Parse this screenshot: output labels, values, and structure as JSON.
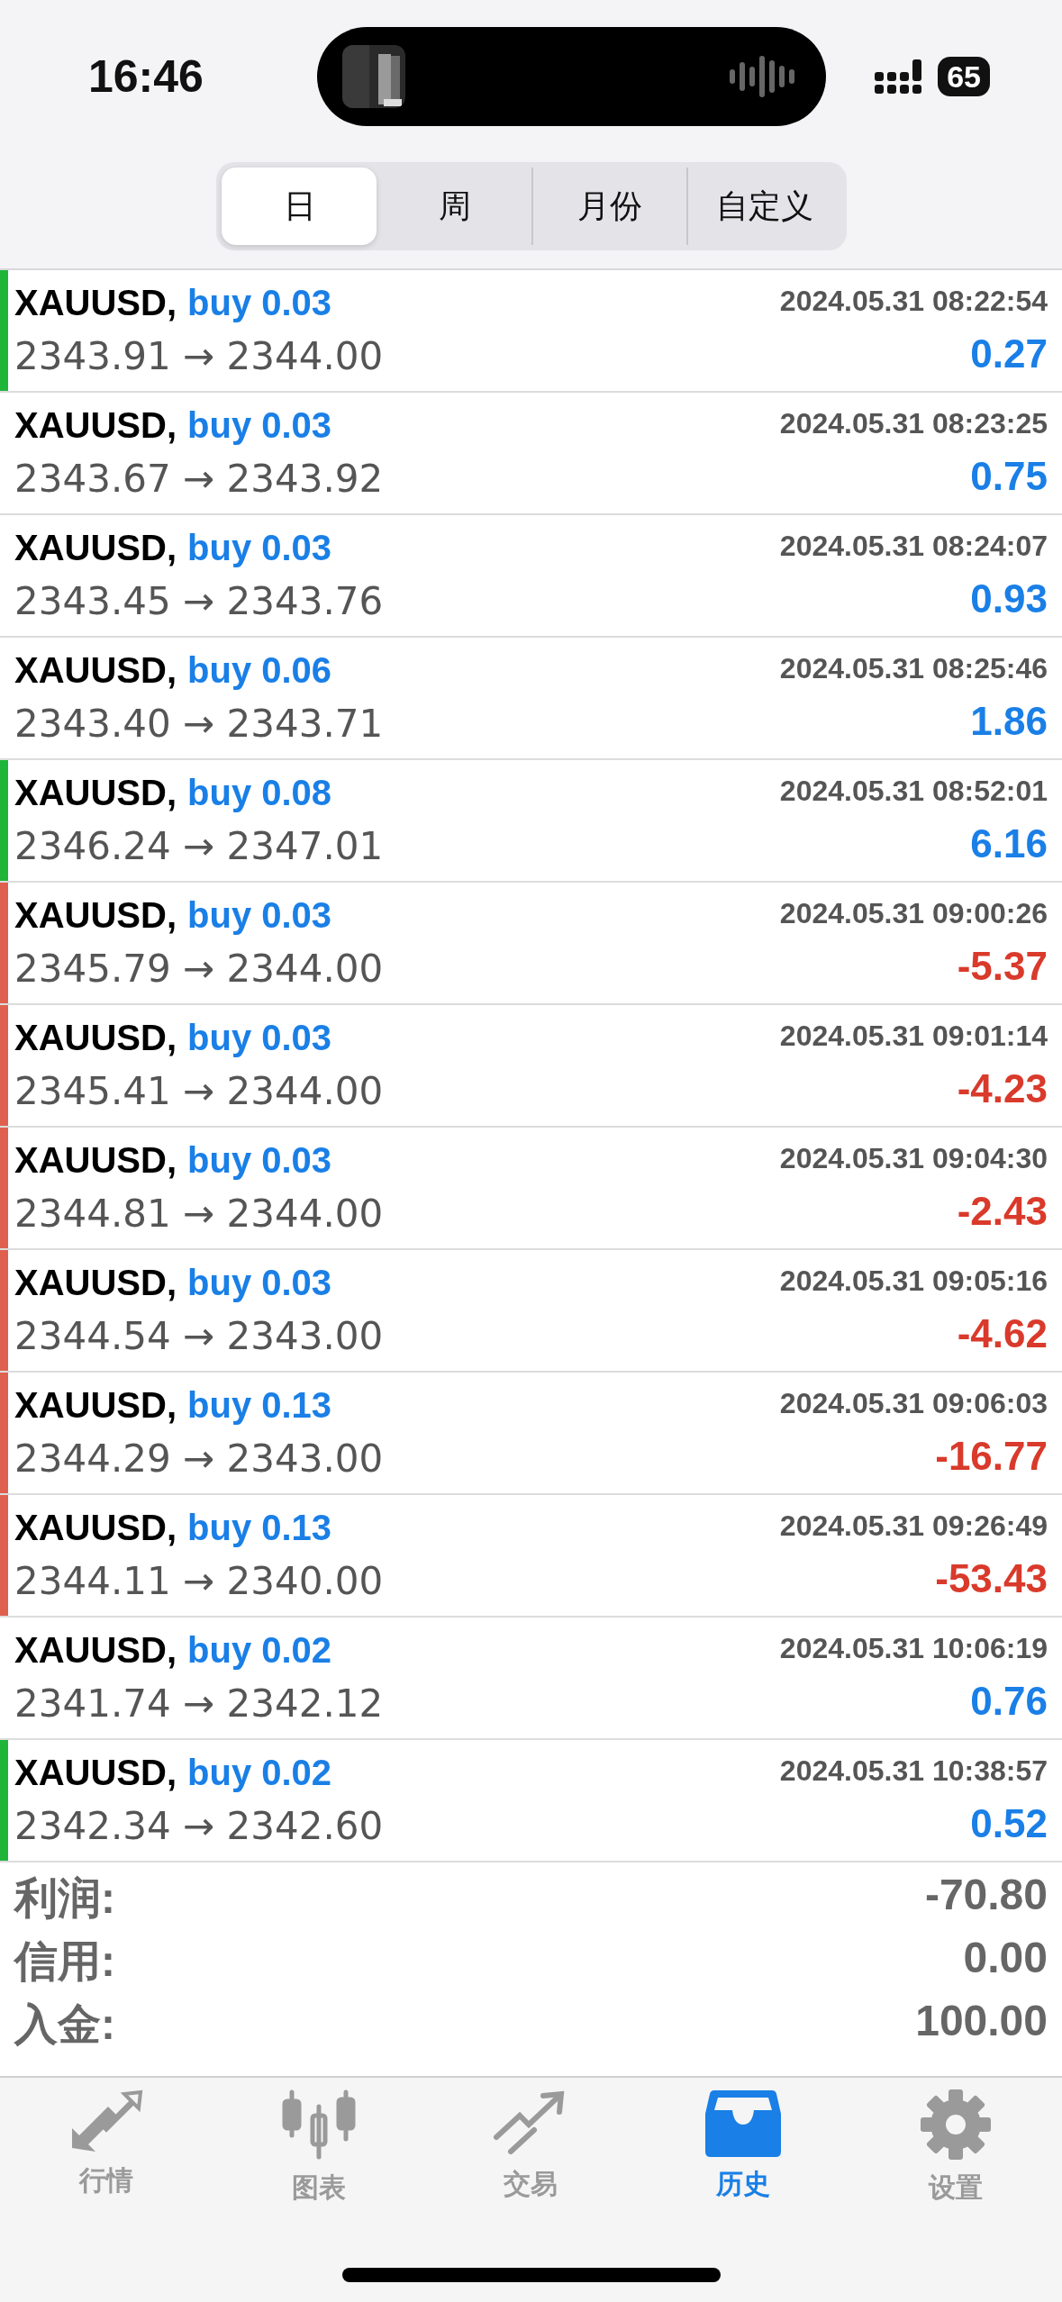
{
  "status_bar": {
    "time": "16:46",
    "battery": "65"
  },
  "tabs": [
    {
      "label": "日",
      "selected": true
    },
    {
      "label": "周",
      "selected": false
    },
    {
      "label": "月份",
      "selected": false
    },
    {
      "label": "自定义",
      "selected": false
    }
  ],
  "deals": [
    {
      "symbol": "XAUUSD,",
      "side": "buy 0.03",
      "time": "2024.05.31 08:22:54",
      "prices": "2343.91 → 2344.00",
      "profit": "0.27",
      "kind": "gain",
      "color": "#1fb53a"
    },
    {
      "symbol": "XAUUSD,",
      "side": "buy 0.03",
      "time": "2024.05.31 08:23:25",
      "prices": "2343.67 → 2343.92",
      "profit": "0.75",
      "kind": "gain"
    },
    {
      "symbol": "XAUUSD,",
      "side": "buy 0.03",
      "time": "2024.05.31 08:24:07",
      "prices": "2343.45 → 2343.76",
      "profit": "0.93",
      "kind": "gain"
    },
    {
      "symbol": "XAUUSD,",
      "side": "buy 0.06",
      "time": "2024.05.31 08:25:46",
      "prices": "2343.40 → 2343.71",
      "profit": "1.86",
      "kind": "gain"
    },
    {
      "symbol": "XAUUSD,",
      "side": "buy 0.08",
      "time": "2024.05.31 08:52:01",
      "prices": "2346.24 → 2347.01",
      "profit": "6.16",
      "kind": "gain",
      "color": "#1fb53a"
    },
    {
      "symbol": "XAUUSD,",
      "side": "buy 0.03",
      "time": "2024.05.31 09:00:26",
      "prices": "2345.79 → 2344.00",
      "profit": "-5.37",
      "kind": "loss",
      "color": "#e0604f"
    },
    {
      "symbol": "XAUUSD,",
      "side": "buy 0.03",
      "time": "2024.05.31 09:01:14",
      "prices": "2345.41 → 2344.00",
      "profit": "-4.23",
      "kind": "loss",
      "color": "#e0604f"
    },
    {
      "symbol": "XAUUSD,",
      "side": "buy 0.03",
      "time": "2024.05.31 09:04:30",
      "prices": "2344.81 → 2344.00",
      "profit": "-2.43",
      "kind": "loss",
      "color": "#e0604f"
    },
    {
      "symbol": "XAUUSD,",
      "side": "buy 0.03",
      "time": "2024.05.31 09:05:16",
      "prices": "2344.54 → 2343.00",
      "profit": "-4.62",
      "kind": "loss",
      "color": "#e0604f"
    },
    {
      "symbol": "XAUUSD,",
      "side": "buy 0.13",
      "time": "2024.05.31 09:06:03",
      "prices": "2344.29 → 2343.00",
      "profit": "-16.77",
      "kind": "loss",
      "color": "#e0604f"
    },
    {
      "symbol": "XAUUSD,",
      "side": "buy 0.13",
      "time": "2024.05.31 09:26:49",
      "prices": "2344.11 → 2340.00",
      "profit": "-53.43",
      "kind": "loss",
      "color": "#e0604f"
    },
    {
      "symbol": "XAUUSD,",
      "side": "buy 0.02",
      "time": "2024.05.31 10:06:19",
      "prices": "2341.74 → 2342.12",
      "profit": "0.76",
      "kind": "gain"
    },
    {
      "symbol": "XAUUSD,",
      "side": "buy 0.02",
      "time": "2024.05.31 10:38:57",
      "prices": "2342.34 → 2342.60",
      "profit": "0.52",
      "kind": "gain",
      "color": "#1fb53a"
    }
  ],
  "summary": [
    {
      "label": "利润:",
      "value": "-70.80"
    },
    {
      "label": "信用:",
      "value": "0.00"
    },
    {
      "label": "入金:",
      "value": "100.00"
    }
  ],
  "tab_bar": [
    {
      "label": "行情",
      "kind": "arrows",
      "selected": false
    },
    {
      "label": "图表",
      "kind": "candles",
      "selected": false
    },
    {
      "label": "交易",
      "kind": "trend",
      "selected": false
    },
    {
      "label": "历史",
      "kind": "inbox",
      "selected": true
    },
    {
      "label": "设置",
      "kind": "gear",
      "selected": false
    }
  ]
}
